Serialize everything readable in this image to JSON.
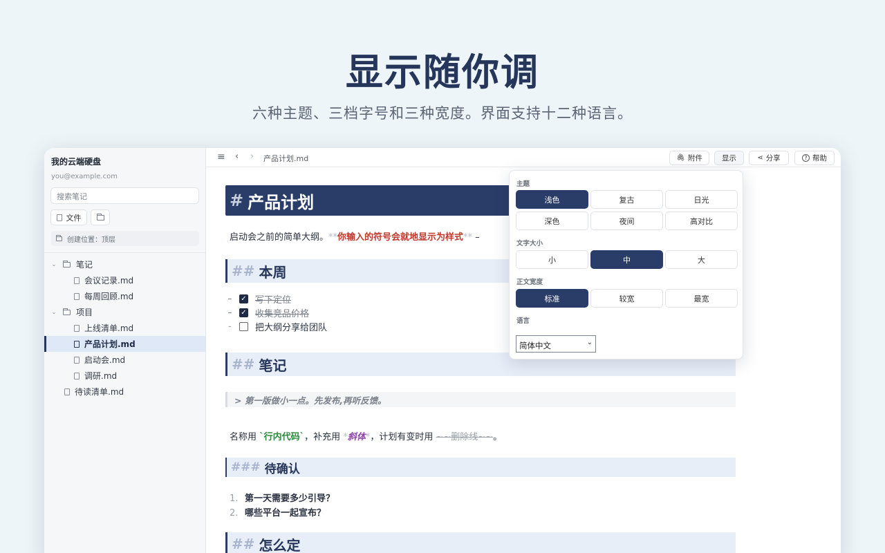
{
  "hero": {
    "title": "显示随你调",
    "subtitle": "六种主题、三档字号和三种宽度。界面支持十二种语言。"
  },
  "sidebar": {
    "account_name": "我的云端硬盘",
    "email": "you@example.com",
    "search_placeholder": "搜索笔记",
    "new_file_label": "文件",
    "create_location": "创建位置：顶层",
    "tree": [
      {
        "label": "笔记",
        "type": "folder",
        "expanded": true
      },
      {
        "label": "会议记录.md",
        "type": "file"
      },
      {
        "label": "每周回顾.md",
        "type": "file"
      },
      {
        "label": "项目",
        "type": "folder",
        "expanded": true
      },
      {
        "label": "上线清单.md",
        "type": "file"
      },
      {
        "label": "产品计划.md",
        "type": "file",
        "active": true
      },
      {
        "label": "启动会.md",
        "type": "file"
      },
      {
        "label": "调研.md",
        "type": "file"
      },
      {
        "label": "待读清单.md",
        "type": "file"
      }
    ]
  },
  "toolbar": {
    "filename": "产品计划.md",
    "attach_label": "附件",
    "display_label": "显示",
    "share_label": "分享",
    "help_label": "帮助"
  },
  "doc": {
    "h1_mark": "#",
    "h1_text": "产品计划",
    "intro_text": "启动会之前的简单大纲。",
    "intro_mark_open": "**",
    "intro_bold": "你输入的符号会就地显示为样式",
    "intro_mark_close": "**",
    "intro_tail": "–",
    "h2_mark": "##",
    "h2_week": "本周",
    "task_dash": "-",
    "tasks": [
      {
        "label": "写下定位",
        "done": true
      },
      {
        "label": "收集竞品价格",
        "done": true
      },
      {
        "label": "把大纲分享给团队",
        "done": false
      }
    ],
    "h2_notes": "笔记",
    "quote": "> 第一版做小一点。先发布,再听反馈。",
    "inline": {
      "part1": "名称用",
      "code": "`行内代码`",
      "part2": "，补充用",
      "ital_mark1": "*",
      "italic": "斜体",
      "ital_mark2": "*",
      "part3": "，计划有变时用",
      "strike": "~~删除线~~",
      "part4": "。"
    },
    "h3_mark": "###",
    "h3_text": "待确认",
    "ordered": [
      {
        "num": "1.",
        "text": "第一天需要多少引导？"
      },
      {
        "num": "2.",
        "text": "哪些平台一起宣布？"
      }
    ],
    "h2_decide": "怎么定"
  },
  "popup": {
    "theme_label": "主题",
    "themes": [
      "浅色",
      "复古",
      "日光",
      "深色",
      "夜间",
      "高对比"
    ],
    "theme_selected": "浅色",
    "size_label": "文字大小",
    "sizes": [
      "小",
      "中",
      "大"
    ],
    "size_selected": "中",
    "width_label": "正文宽度",
    "widths": [
      "标准",
      "较宽",
      "最宽"
    ],
    "width_selected": "标准",
    "language_label": "语言",
    "language_value": "简体中文"
  },
  "colors": {
    "accent": "#2a3c68",
    "background": "#eef5f8",
    "bold_red": "#c0392b",
    "code_green": "#2a8a3a",
    "italic_purple": "#8e44ad"
  }
}
